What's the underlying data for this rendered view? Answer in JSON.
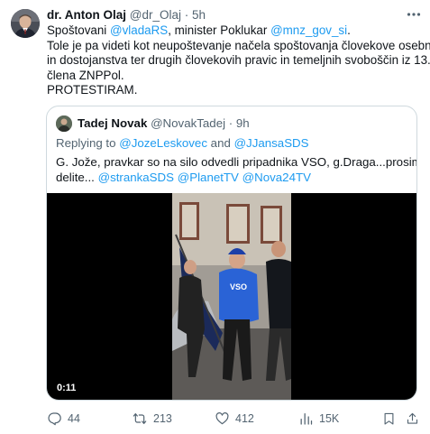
{
  "author": {
    "name": "dr. Anton Olaj",
    "handle": "@dr_Olaj",
    "separator": "·",
    "time": "5h"
  },
  "tweet": {
    "l1": {
      "a": "Spoštovani ",
      "b": "@vladaRS",
      "c": ", minister Poklukar ",
      "d": "@mnz_gov_si",
      "e": "."
    },
    "l2": "Tole je pa videti kot neupoštevanje načela spoštovanja človekove osebnosti",
    "l3": "in dostojanstva ter drugih človekovih pravic in temeljnih svoboščin iz 13.",
    "l4": "člena ZNPPol.",
    "l5": "PROTESTIRAM."
  },
  "quote": {
    "name": "Tadej Novak",
    "handle": "@NovakTadej",
    "separator": "·",
    "time": "9h",
    "replying_prefix": "Replying to ",
    "replying_user1": "@JozeLeskovec",
    "replying_and": " and ",
    "replying_user2": "@JJansaSDS",
    "text_line1": "G. Jože, pravkar so na silo odvedli pripadnika VSO, g.Draga...prosim",
    "text_line2": {
      "a": "delite... ",
      "b": "@strankaSDS",
      "c": " ",
      "d": "@PlanetTV",
      "e": " ",
      "f": "@Nova24TV"
    },
    "video_duration": "0:11",
    "shirt_text": "VSO"
  },
  "actions": {
    "replies": "44",
    "retweets": "213",
    "likes": "412",
    "views": "15K"
  },
  "icons": {
    "more": "more-icon",
    "reply": "reply-icon",
    "retweet": "retweet-icon",
    "like": "heart-icon",
    "views": "views-icon",
    "bookmark": "bookmark-icon",
    "share": "share-icon"
  },
  "colors": {
    "link": "#1d9bf0",
    "muted": "#536471",
    "text": "#0f1419",
    "border": "#cfd9de"
  }
}
